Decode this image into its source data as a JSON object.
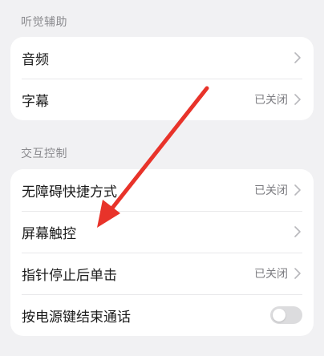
{
  "sections": [
    {
      "header": "听觉辅助",
      "items": [
        {
          "label": "音频",
          "status": "",
          "control": "chevron"
        },
        {
          "label": "字幕",
          "status": "已关闭",
          "control": "chevron"
        }
      ]
    },
    {
      "header": "交互控制",
      "items": [
        {
          "label": "无障碍快捷方式",
          "status": "已关闭",
          "control": "chevron"
        },
        {
          "label": "屏幕触控",
          "status": "",
          "control": "chevron"
        },
        {
          "label": "指针停止后单击",
          "status": "已关闭",
          "control": "chevron"
        },
        {
          "label": "按电源键结束通话",
          "status": "",
          "control": "toggle",
          "toggle_on": false
        }
      ]
    }
  ],
  "colors": {
    "background": "#f1f1f3",
    "card": "#ffffff",
    "annotation_arrow": "#e8332a",
    "toggle_off": "#dcdcde"
  },
  "icons": {
    "chevron": "chevron-right-icon",
    "toggle": "toggle-switch"
  }
}
